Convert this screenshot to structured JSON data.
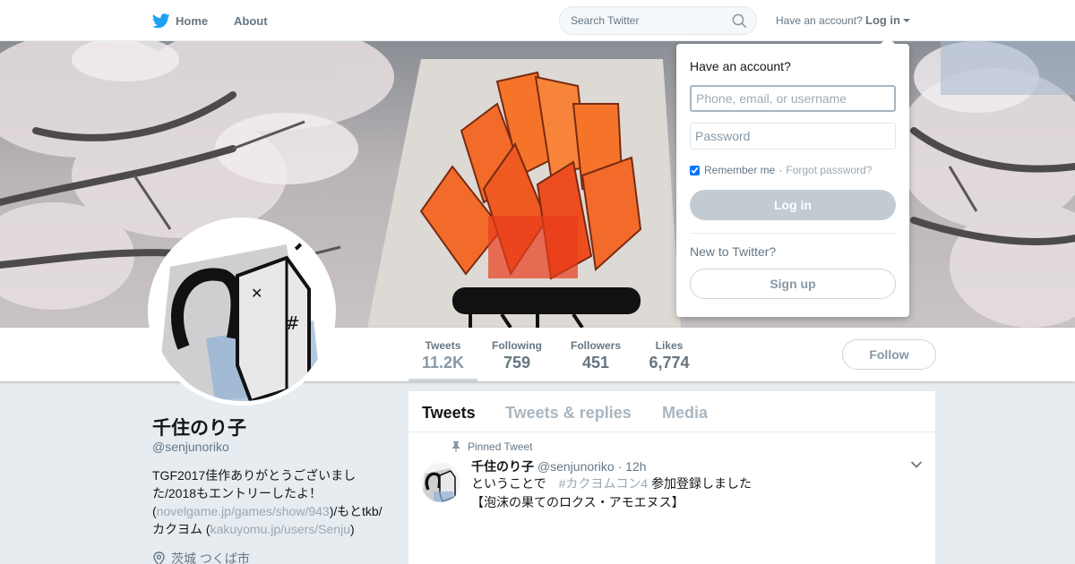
{
  "nav": {
    "home_label": "Home",
    "about_label": "About",
    "search_placeholder": "Search Twitter",
    "have_account": "Have an account?",
    "login_label": "Log in"
  },
  "profile": {
    "name": "千住のり子",
    "handle": "@senjunoriko",
    "bio_part1": "TGF2017佳作ありがとうございました/2018もエントリーしたよ！(",
    "bio_link1": "novelgame.jp/games/show/943",
    "bio_part2": ")/もとtkb/カクヨム (",
    "bio_link2": "kakuyomu.jp/users/Senju",
    "bio_part3": ")",
    "location": "茨城 つくば市"
  },
  "stats": [
    {
      "label": "Tweets",
      "value": "11.2K"
    },
    {
      "label": "Following",
      "value": "759"
    },
    {
      "label": "Followers",
      "value": "451"
    },
    {
      "label": "Likes",
      "value": "6,774"
    }
  ],
  "follow_label": "Follow",
  "timeline": {
    "tabs": [
      "Tweets",
      "Tweets & replies",
      "Media"
    ],
    "pinned_label": "Pinned Tweet",
    "tweet": {
      "name": "千住のり子",
      "handle": "@senjunoriko",
      "time": "· 12h",
      "text_line1_prefix": "ということで　",
      "hashtag": "#カクヨムコン4",
      "text_line1_suffix": " 参加登録しました",
      "text_line2": "【泡沫の果てのロクス・アモエヌス】"
    }
  },
  "login_dropdown": {
    "title": "Have an account?",
    "username_placeholder": "Phone, email, or username",
    "password_placeholder": "Password",
    "remember_label": "Remember me",
    "separator": "·",
    "forgot_label": "Forgot password?",
    "login_button": "Log in",
    "new_label": "New to Twitter?",
    "signup_button": "Sign up"
  },
  "colors": {
    "twitter_blue": "#1da1f2",
    "flame_orange": "#f5742a"
  }
}
